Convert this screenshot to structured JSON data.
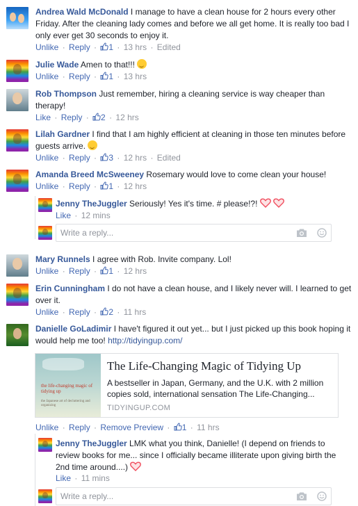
{
  "comments": [
    {
      "name": "Andrea Wald McDonald",
      "text": "I manage to have a clean house for 2 hours every other Friday. After the cleaning lady comes and before we all get home. It is really too bad I only ever get 30 seconds to enjoy it.",
      "unlike": "Unlike",
      "reply": "Reply",
      "likes": "1",
      "time": "13 hrs",
      "edited": "Edited"
    },
    {
      "name": "Julie Wade",
      "text": "Amen to that!!!",
      "unlike": "Unlike",
      "reply": "Reply",
      "likes": "1",
      "time": "13 hrs"
    },
    {
      "name": "Rob Thompson",
      "text": "Just remember, hiring a cleaning service is way cheaper than therapy!",
      "like": "Like",
      "reply": "Reply",
      "likes": "2",
      "time": "12 hrs"
    },
    {
      "name": "Lilah Gardner",
      "text": "I find that I am highly efficient at cleaning in those ten minutes before guests arrive.",
      "unlike": "Unlike",
      "reply": "Reply",
      "likes": "3",
      "time": "12 hrs",
      "edited": "Edited"
    },
    {
      "name": "Amanda Breed McSweeney",
      "text": "Rosemary would love to come clean your house!",
      "unlike": "Unlike",
      "reply": "Reply",
      "likes": "1",
      "time": "12 hrs"
    },
    {
      "name": "Jenny TheJuggler",
      "text": "Seriously! Yes it's time. # please!?!",
      "like": "Like",
      "time": "12 mins"
    },
    {
      "name": "Mary Runnels",
      "text": "I agree with Rob. Invite company. Lol!",
      "unlike": "Unlike",
      "reply": "Reply",
      "likes": "1",
      "time": "12 hrs"
    },
    {
      "name": "Erin Cunningham",
      "text": "I do not have a clean house, and I likely never will. I learned to get over it.",
      "unlike": "Unlike",
      "reply": "Reply",
      "likes": "2",
      "time": "11 hrs"
    },
    {
      "name": "Danielle GoLadimir",
      "text": "I have't figured it out yet... but I just picked up this book hoping it would help me too!",
      "link": "http://tidyingup.com/",
      "unlike": "Unlike",
      "reply": "Reply",
      "remove_preview": "Remove Preview",
      "likes": "1",
      "time": "11 hrs"
    },
    {
      "name": "Jenny TheJuggler",
      "text": "LMK what you think, Danielle! (I depend on friends to review books for me... since I officially became illiterate upon giving birth the 2nd time around....)",
      "like": "Like",
      "time": "11 mins"
    }
  ],
  "preview": {
    "title": "The Life-Changing Magic of Tidying Up",
    "description": "A bestseller in Japan, Germany, and the U.K. with 2 million copies sold, international sensation The Life-Changing...",
    "domain": "TIDYINGUP.COM",
    "book_cover_text": "the life-changing magic of tidying up",
    "book_cover_subtext": "the Japanese art of decluttering and organizing"
  },
  "reply_box": {
    "placeholder": "Write a reply..."
  },
  "colors": {
    "link": "#365899",
    "action": "#4267b2",
    "meta": "#90949c",
    "heart": "#f04d5e"
  },
  "icons": [
    "thumbs-up-icon",
    "camera-icon",
    "emoji-smile-icon",
    "heart-icon",
    "wink-emoji-icon"
  ]
}
